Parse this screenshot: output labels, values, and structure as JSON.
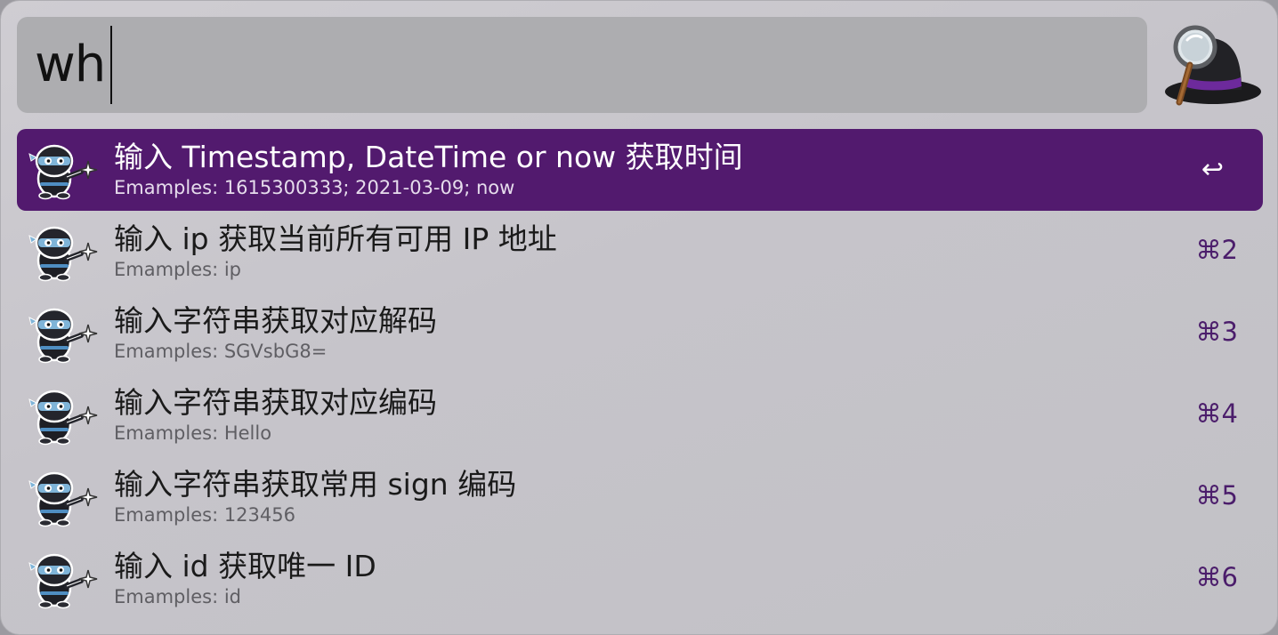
{
  "search": {
    "query": "wh"
  },
  "logo": {
    "icon": "alfred-hat-icon"
  },
  "colors": {
    "selected_row": "#521a6e",
    "shortcut": "#4b1d6b",
    "background": "#c9c8cd"
  },
  "results": [
    {
      "icon": "gopher-ninja-icon",
      "title": "输入 Timestamp, DateTime or now 获取时间",
      "subtitle": "Emamples: 1615300333; 2021-03-09; now",
      "shortcut": "↩",
      "selected": true
    },
    {
      "icon": "gopher-ninja-icon",
      "title": "输入 ip 获取当前所有可用 IP 地址",
      "subtitle": "Emamples: ip",
      "shortcut": "⌘2",
      "selected": false
    },
    {
      "icon": "gopher-ninja-icon",
      "title": "输入字符串获取对应解码",
      "subtitle": "Emamples: SGVsbG8=",
      "shortcut": "⌘3",
      "selected": false
    },
    {
      "icon": "gopher-ninja-icon",
      "title": "输入字符串获取对应编码",
      "subtitle": "Emamples: Hello",
      "shortcut": "⌘4",
      "selected": false
    },
    {
      "icon": "gopher-ninja-icon",
      "title": "输入字符串获取常用 sign 编码",
      "subtitle": "Emamples: 123456",
      "shortcut": "⌘5",
      "selected": false
    },
    {
      "icon": "gopher-ninja-icon",
      "title": "输入 id 获取唯一 ID",
      "subtitle": "Emamples: id",
      "shortcut": "⌘6",
      "selected": false
    }
  ]
}
